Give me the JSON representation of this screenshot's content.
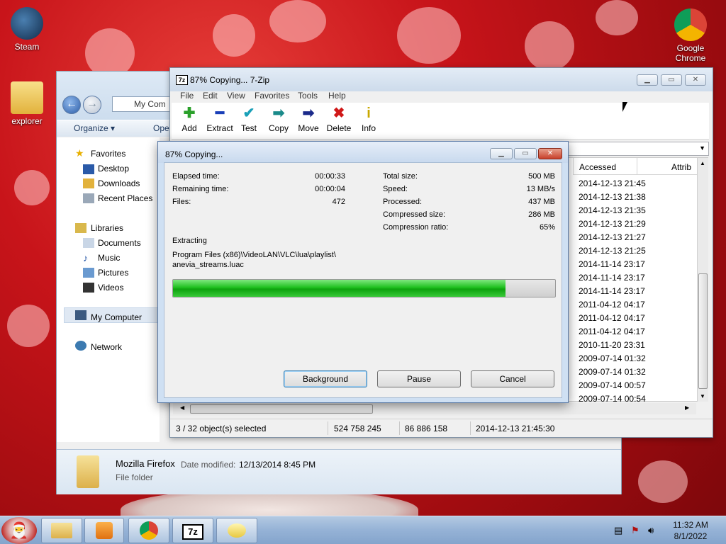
{
  "desktop": {
    "icons": [
      {
        "label": "Steam",
        "icon": "steam-icon"
      },
      {
        "label": "explorer",
        "icon": "folder-icon"
      },
      {
        "label": "Google Chrome",
        "icon": "chrome-icon"
      }
    ]
  },
  "explorer": {
    "address": "My Com",
    "toolbar": {
      "organize": "Organize ▾",
      "open": "Oper"
    },
    "nav": {
      "favorites": "Favorites",
      "desktop": "Desktop",
      "downloads": "Downloads",
      "recent": "Recent Places",
      "libraries": "Libraries",
      "documents": "Documents",
      "music": "Music",
      "pictures": "Pictures",
      "videos": "Videos",
      "computer": "My Computer",
      "network": "Network"
    },
    "details": {
      "name": "Mozilla Firefox",
      "date_label": "Date modified:",
      "date_value": "12/13/2014 8:45 PM",
      "type": "File folder"
    }
  },
  "zip": {
    "title": "87% Copying... 7-Zip",
    "logo": "7z",
    "menu": [
      "File",
      "Edit",
      "View",
      "Favorites",
      "Tools",
      "Help"
    ],
    "tools": [
      {
        "label": "Add",
        "glyph": "✚",
        "color": "#2aa02a"
      },
      {
        "label": "Extract",
        "glyph": "━",
        "color": "#1a3fb8"
      },
      {
        "label": "Test",
        "glyph": "✔",
        "color": "#1aa0b8"
      },
      {
        "label": "Copy",
        "glyph": "➡",
        "color": "#1a8a8a"
      },
      {
        "label": "Move",
        "glyph": "➡",
        "color": "#1a2a8a"
      },
      {
        "label": "Delete",
        "glyph": "✖",
        "color": "#d01818"
      },
      {
        "label": "Info",
        "glyph": "i",
        "color": "#c9a800"
      }
    ],
    "columns": {
      "accessed": "Accessed",
      "attrib": "Attrib"
    },
    "accessed_rows": [
      "2014-12-13 21:45",
      "2014-12-13 21:38",
      "2014-12-13 21:35",
      "2014-12-13 21:29",
      "2014-12-13 21:27",
      "2014-12-13 21:25",
      "2014-11-14 23:17",
      "2014-11-14 23:17",
      "2014-11-14 23:17",
      "2011-04-12 04:17",
      "2011-04-12 04:17",
      "2011-04-12 04:17",
      "2010-11-20 23:31",
      "2009-07-14 01:32",
      "2009-07-14 01:32",
      "2009-07-14 00:57",
      "2009-07-14 00:54"
    ],
    "status": {
      "selected": "3 / 32 object(s) selected",
      "size": "524 758 245",
      "packed": "86 886 158",
      "modified": "2014-12-13 21:45:30"
    }
  },
  "dialog": {
    "title": "87% Copying...",
    "elapsed_label": "Elapsed time:",
    "elapsed_value": "00:00:33",
    "remaining_label": "Remaining time:",
    "remaining_value": "00:00:04",
    "files_label": "Files:",
    "files_value": "472",
    "total_label": "Total size:",
    "total_value": "500 MB",
    "speed_label": "Speed:",
    "speed_value": "13 MB/s",
    "processed_label": "Processed:",
    "processed_value": "437 MB",
    "compressed_label": "Compressed size:",
    "compressed_value": "286 MB",
    "ratio_label": "Compression ratio:",
    "ratio_value": "65%",
    "operation": "Extracting",
    "path_line1": "Program Files (x86)\\VideoLAN\\VLC\\lua\\playlist\\",
    "path_line2": "anevia_streams.luac",
    "progress": 0.87,
    "buttons": {
      "background": "Background",
      "pause": "Pause",
      "cancel": "Cancel"
    }
  },
  "taskbar": {
    "time": "11:32 AM",
    "date": "8/1/2022",
    "zip_label": "7z"
  }
}
